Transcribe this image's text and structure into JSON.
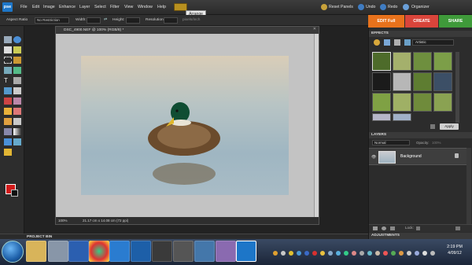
{
  "app": {
    "logo": "pse"
  },
  "menu": [
    "File",
    "Edit",
    "Image",
    "Enhance",
    "Layer",
    "Select",
    "Filter",
    "View",
    "Window",
    "Help"
  ],
  "tooltip": "Arrange",
  "top_right": {
    "reset_panels": "Reset Panels",
    "undo": "Undo",
    "redo": "Redo",
    "organizer": "Organizer"
  },
  "options": {
    "aspect_label": "Aspect Ratio",
    "aspect_value": "No Restriction",
    "width_label": "Width:",
    "height_label": "Height:",
    "resolution_label": "Resolution:",
    "resolution_unit": "pixels/inch"
  },
  "modes": {
    "edit_full": "EDIT Full",
    "create": "CREATE",
    "share": "SHARE"
  },
  "document": {
    "tab_title": "DSC_4900.NEF @ 100% (RGB/8) *",
    "zoom": "100%",
    "doc_info": "21.17 cm x 14.08 cm (72 ppi)"
  },
  "panels": {
    "effects_title": "EFFECTS",
    "effects_filter": "Artistic",
    "apply": "Apply",
    "layers_title": "LAYERS",
    "blend_mode": "Normal",
    "opacity_label": "Opacity:",
    "opacity_value": "100%",
    "layer_name": "Background",
    "lock_label": "Lock:",
    "adjustments": "ADJUSTMENTS"
  },
  "project_bin": "PROJECT BIN",
  "taskbar": {
    "time": "2:19 PM",
    "date": "4/09/12"
  },
  "colors": {
    "foreground": "#d21a1a",
    "background": "#111111",
    "edit_full": "#e8721c",
    "create": "#d9453b",
    "share": "#3f9a3a"
  }
}
